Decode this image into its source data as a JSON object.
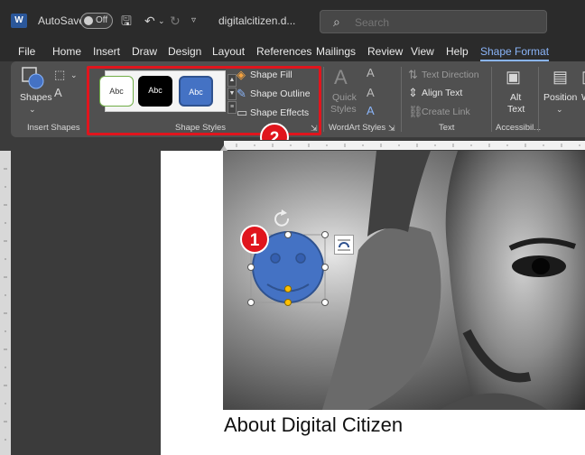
{
  "titlebar": {
    "autosave_label": "AutoSave",
    "autosave_state": "Off",
    "doc_name": "digitalcitizen.d...",
    "search_placeholder": "Search"
  },
  "menu_tabs": [
    "File",
    "Home",
    "Insert",
    "Draw",
    "Design",
    "Layout",
    "References",
    "Mailings",
    "Review",
    "View",
    "Help",
    "Shape Format"
  ],
  "active_tab": "Shape Format",
  "ribbon": {
    "insert_shapes": {
      "shapes_label": "Shapes",
      "group_label": "Insert Shapes"
    },
    "shape_styles": {
      "swatches": [
        "Abc",
        "Abc",
        "Abc"
      ],
      "fill_label": "Shape Fill",
      "outline_label": "Shape Outline",
      "effects_label": "Shape Effects",
      "group_label": "Shape Styles"
    },
    "wordart": {
      "quick_label": "Quick",
      "styles_label": "Styles",
      "group_label": "WordArt Styles"
    },
    "text": {
      "direction_label": "Text Direction",
      "align_label": "Align Text",
      "link_label": "Create Link",
      "group_label": "Text"
    },
    "accessibility": {
      "alt_label": "Alt",
      "text_label": "Text",
      "group_label": "Accessibil..."
    },
    "arrange": {
      "position_label": "Position"
    }
  },
  "badges": {
    "shape": "1",
    "styles": "2"
  },
  "document": {
    "heading": "About Digital Citizen"
  },
  "colors": {
    "accent": "#8ab4f8",
    "highlight": "#e0151d",
    "shape_fill": "#4472c4",
    "handle": "#ffc000"
  }
}
